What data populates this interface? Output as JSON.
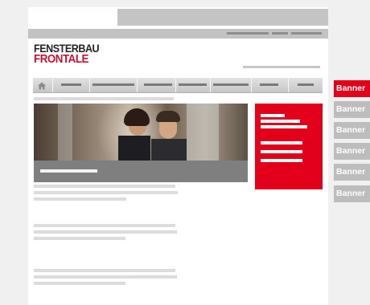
{
  "header": {
    "logo_line1": "FENSTERBAU",
    "logo_line2": "FRONTALE"
  },
  "colors": {
    "brand_red": "#e2001a",
    "banner_active": "#e2001a",
    "banner_inactive": "#bdbdbd"
  },
  "icons": {
    "nav_home": "home-icon"
  },
  "banners": [
    {
      "label": "Banner",
      "active": true
    },
    {
      "label": "Banner",
      "active": false
    },
    {
      "label": "Banner",
      "active": false
    },
    {
      "label": "Banner",
      "active": false
    },
    {
      "label": "Banner",
      "active": false
    },
    {
      "label": "Banner",
      "active": false
    }
  ]
}
